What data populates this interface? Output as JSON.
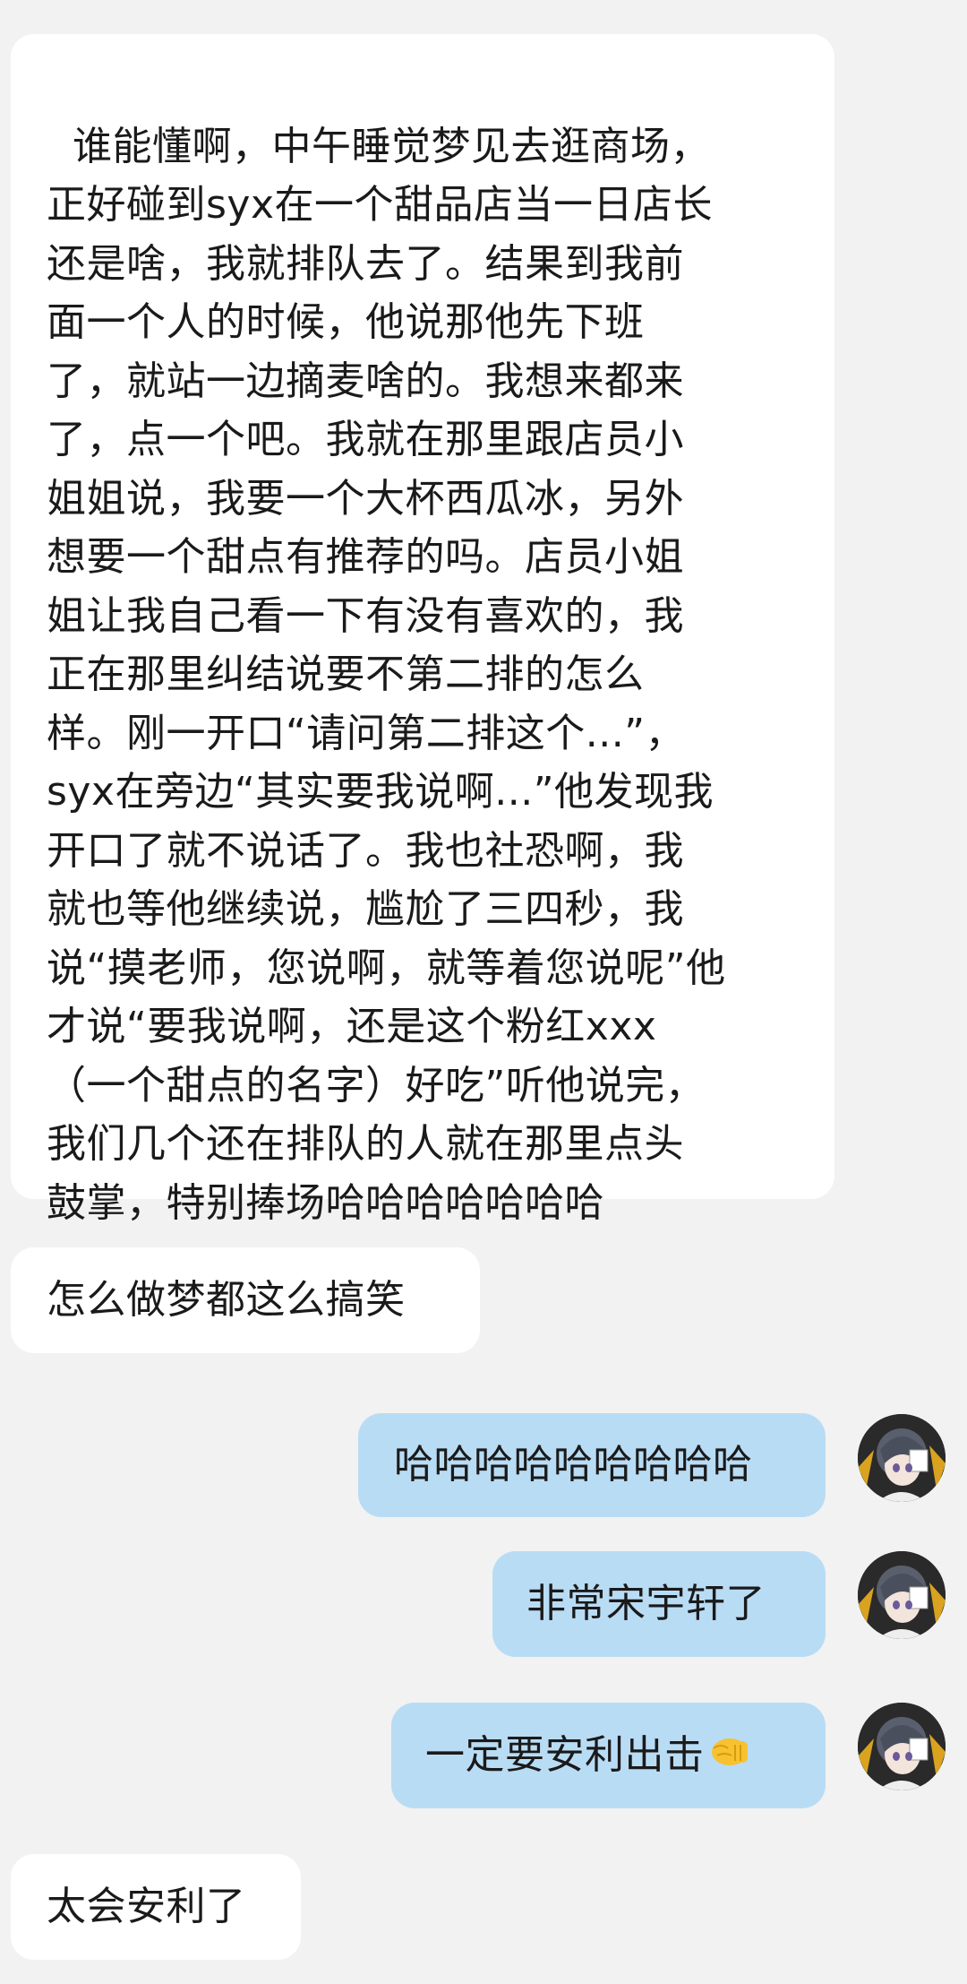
{
  "messages": [
    {
      "sender": "other",
      "text": "谁能懂啊，中午睡觉梦见去逛商场，\n正好碰到syx在一个甜品店当一日店长\n还是啥，我就排队去了。结果到我前\n面一个人的时候，他说那他先下班\n了，就站一边摘麦啥的。我想来都来\n了，点一个吧。我就在那里跟店员小\n姐姐说，我要一个大杯西瓜冰，另外\n想要一个甜点有推荐的吗。店员小姐\n姐让我自己看一下有没有喜欢的，我\n正在那里纠结说要不第二排的怎么\n样。刚一开口“请问第二排这个...”，\nsyx在旁边“其实要我说啊...”他发现我\n开口了就不说话了。我也社恐啊，我\n就也等他继续说，尴尬了三四秒，我\n说“摸老师，您说啊，就等着您说呢”他\n才说“要我说啊，还是这个粉红xxx\n（一个甜点的名字）好吃”听他说完，\n我们几个还在排队的人就在那里点头\n鼓掌，特别捧场哈哈哈哈哈哈哈"
    },
    {
      "sender": "other",
      "text": "怎么做梦都这么搞笑"
    },
    {
      "sender": "me",
      "text": "哈哈哈哈哈哈哈哈哈"
    },
    {
      "sender": "me",
      "text": "非常宋宇轩了"
    },
    {
      "sender": "me",
      "text": "一定要安利出击",
      "emoji": "🤜"
    },
    {
      "sender": "other",
      "text": "太会安利了"
    }
  ],
  "avatar": {
    "icon": "anime-character-avatar-icon"
  },
  "colors": {
    "background": "#f2f2f2",
    "incoming_bubble": "#ffffff",
    "outgoing_bubble": "#b9dcf5",
    "text": "#1a1a1a"
  }
}
